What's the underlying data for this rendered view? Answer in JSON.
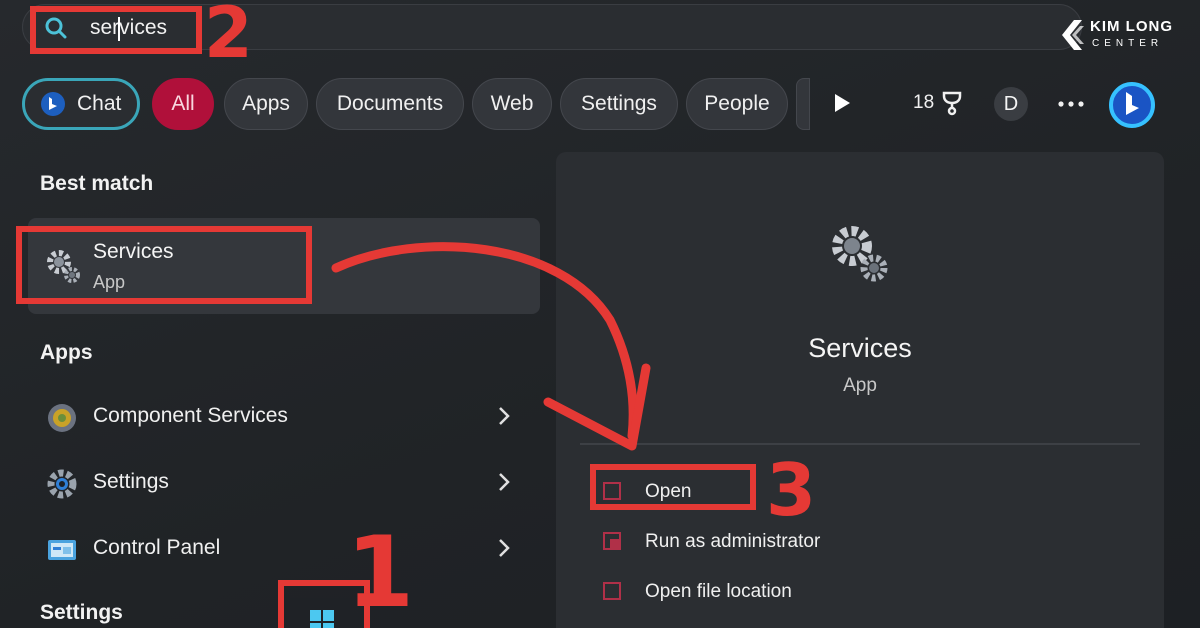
{
  "search": {
    "query": "services",
    "icon": "search-icon"
  },
  "logo": {
    "title": "KIM LONG",
    "subtitle": "CENTER"
  },
  "filters": {
    "chat": "Chat",
    "all": "All",
    "apps": "Apps",
    "documents": "Documents",
    "web": "Web",
    "settings": "Settings",
    "people": "People",
    "rewards_count": "18",
    "avatar_initial": "D",
    "more": "···"
  },
  "left": {
    "best_match_title": "Best match",
    "best_match": {
      "name": "Services",
      "type": "App",
      "icon": "gear-icon"
    },
    "apps_title": "Apps",
    "apps": [
      {
        "label": "Component Services",
        "icon": "component-services-icon"
      },
      {
        "label": "Settings",
        "icon": "settings-gear-icon"
      },
      {
        "label": "Control Panel",
        "icon": "control-panel-icon"
      }
    ],
    "settings_title": "Settings"
  },
  "preview": {
    "name": "Services",
    "type": "App",
    "actions": [
      {
        "label": "Open",
        "icon": "open-icon"
      },
      {
        "label": "Run as administrator",
        "icon": "shield-icon"
      },
      {
        "label": "Open file location",
        "icon": "folder-icon"
      }
    ]
  },
  "annotations": {
    "step1": "1",
    "step2": "2",
    "step3": "3",
    "color": "#e53935"
  },
  "colors": {
    "accent_chat": "#3aa6b9",
    "all_pill": "#b0103a",
    "background": "#202326"
  }
}
